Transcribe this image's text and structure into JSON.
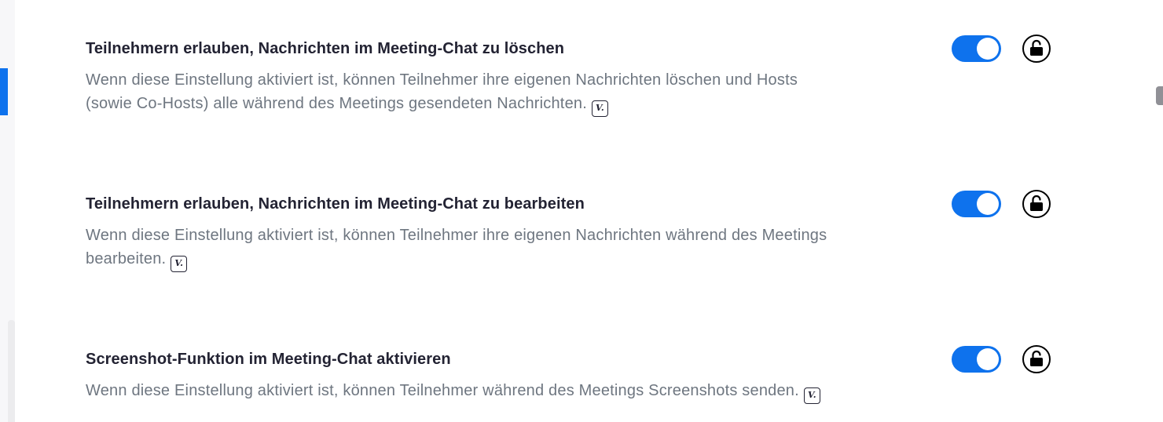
{
  "settings": [
    {
      "title": "Teilnehmern erlauben, Nachrichten im Meeting-Chat zu löschen",
      "description_line1": "Wenn diese Einstellung aktiviert ist, können Teilnehmer ihre eigenen Nachrichten löschen und Hosts",
      "description_line2": "(sowie Co-Hosts) alle während des Meetings gesendeten Nachrichten.",
      "version_badge": "V.",
      "toggle_on": true,
      "lock_icon": "unlocked-lock-icon"
    },
    {
      "title": "Teilnehmern erlauben, Nachrichten im Meeting-Chat zu bearbeiten",
      "description_line1": "Wenn diese Einstellung aktiviert ist, können Teilnehmer ihre eigenen Nachrichten während des Meetings",
      "description_line2": "bearbeiten.",
      "version_badge": "V.",
      "toggle_on": true,
      "lock_icon": "unlocked-lock-icon"
    },
    {
      "title": "Screenshot-Funktion im Meeting-Chat aktivieren",
      "description_line1": "Wenn diese Einstellung aktiviert ist, können Teilnehmer während des Meetings Screenshots senden.",
      "version_badge": "V.",
      "toggle_on": true,
      "lock_icon": "unlocked-lock-icon"
    }
  ],
  "colors": {
    "accent": "#0e72ed",
    "title_text": "#232333",
    "description_text": "#6e7680"
  }
}
